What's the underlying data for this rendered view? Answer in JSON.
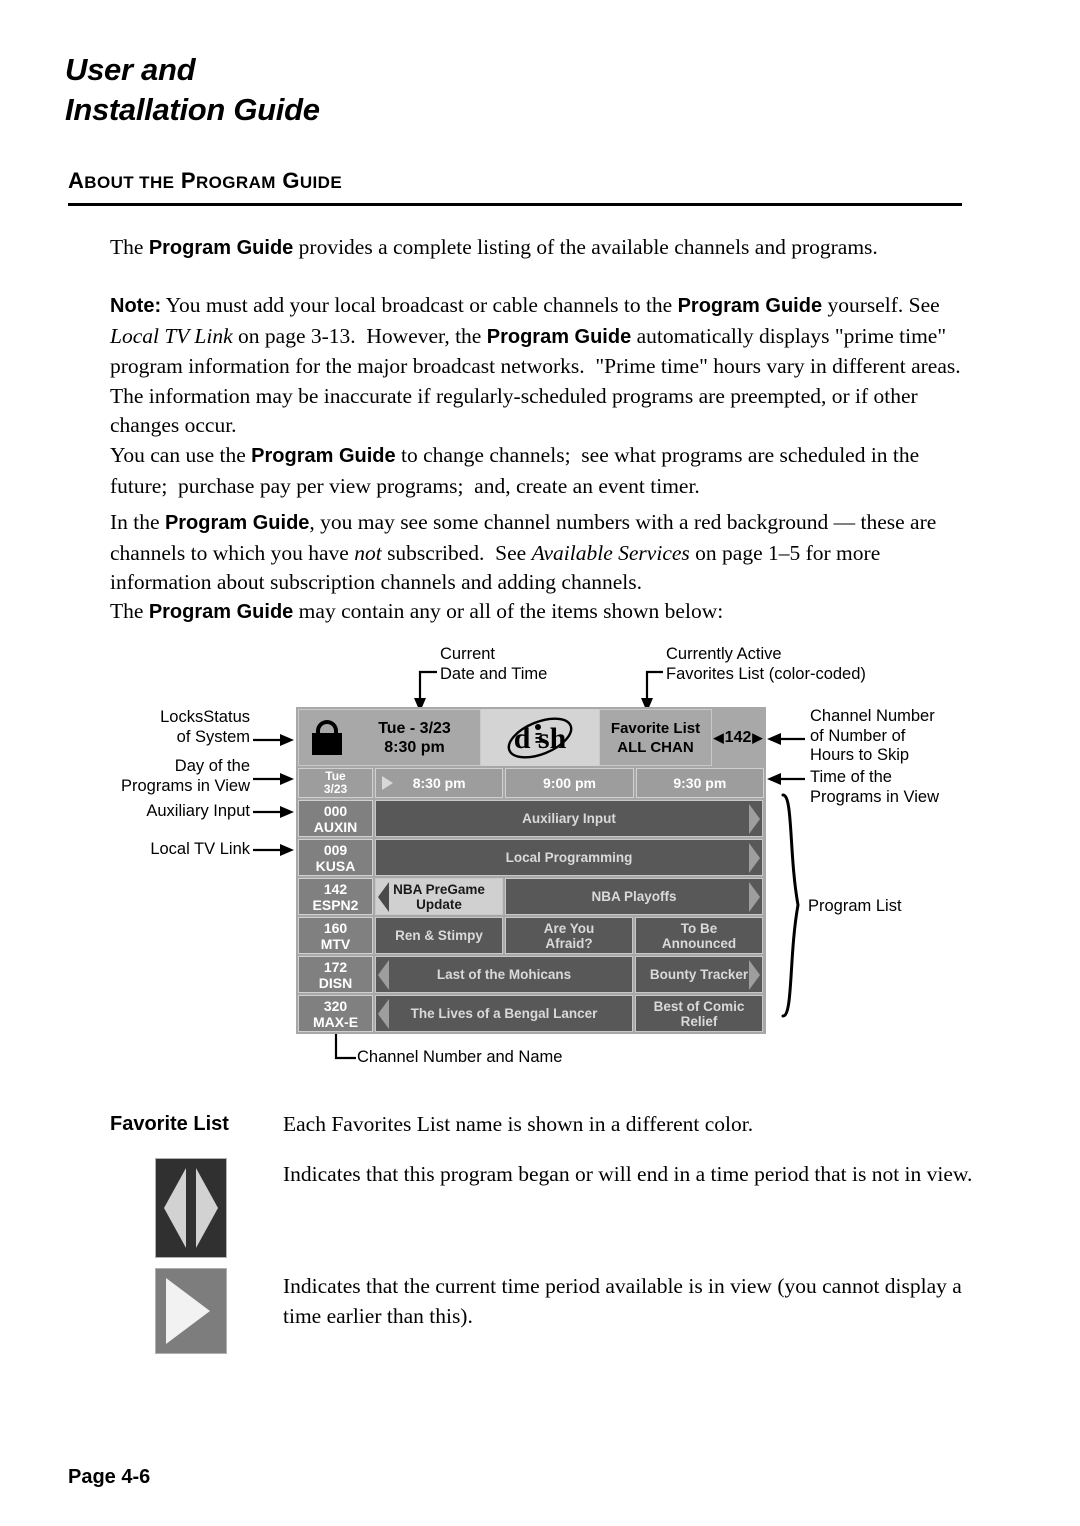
{
  "document": {
    "title_line1": "User and",
    "title_line2": "Installation Guide",
    "section_heading": "About the Program Guide",
    "page_footer": "Page 4-6"
  },
  "paragraphs": {
    "p1_pre": "The ",
    "p1_bold": "Program Guide",
    "p1_post": " provides a complete listing of the available channels and programs.",
    "note_label": "Note:",
    "note_text": "  You must add your local broadcast or cable channels to the Program Guide yourself. See Local TV Link on page 3-13.  However, the Program Guide automatically displays \"prime time\" program information for the major broadcast networks.  \"Prime time\" hours vary in different areas.  The information may be inaccurate if regularly-scheduled programs are preempted, or if other changes occur.",
    "p3": "You can use the Program Guide to change channels;  see what programs are scheduled in the future;  purchase pay per view programs;  and, create an event timer.",
    "p4": "In the Program Guide, you may see some channel numbers with a red background — these are channels to which you have not subscribed.  See Available Services on page 1–5 for more information about subscription channels and adding channels.",
    "p5": "The Program Guide may contain any or all of the items shown below:"
  },
  "guide": {
    "lock_icon": "padlock-icon",
    "date": "Tue - 3/23",
    "time": "8:30 pm",
    "logo": "dish-logo",
    "favorite_label": "Favorite List",
    "favorite_value": "ALL CHAN",
    "channel_skip": "142",
    "skip_left_arrow": "◀",
    "skip_right_arrow": "▶",
    "day_line1": "Tue",
    "day_line2": "3/23",
    "time_columns": [
      "8:30 pm",
      "9:00 pm",
      "9:30 pm"
    ],
    "rows": [
      {
        "number": "000",
        "name": "AUXIN",
        "programs": [
          {
            "title": "Auxiliary Input",
            "span": 3,
            "left_cap": false,
            "right_cap": true,
            "selected": false
          }
        ]
      },
      {
        "number": "009",
        "name": "KUSA",
        "programs": [
          {
            "title": "Local Programming",
            "span": 3,
            "left_cap": false,
            "right_cap": true,
            "selected": false
          }
        ]
      },
      {
        "number": "142",
        "name": "ESPN2",
        "programs": [
          {
            "title": "NBA PreGame Update",
            "span": 1,
            "left_cap": true,
            "right_cap": false,
            "selected": true
          },
          {
            "title": "NBA Playoffs",
            "span": 2,
            "left_cap": false,
            "right_cap": true,
            "selected": false
          }
        ]
      },
      {
        "number": "160",
        "name": "MTV",
        "programs": [
          {
            "title": "Ren & Stimpy",
            "span": 1,
            "left_cap": false,
            "right_cap": false,
            "selected": false
          },
          {
            "title": "Are You Afraid?",
            "span": 1,
            "left_cap": false,
            "right_cap": false,
            "selected": false
          },
          {
            "title": "To Be Announced",
            "span": 1,
            "left_cap": false,
            "right_cap": false,
            "selected": false
          }
        ]
      },
      {
        "number": "172",
        "name": "DISN",
        "programs": [
          {
            "title": "Last of the Mohicans",
            "span": 2,
            "left_cap": true,
            "right_cap": false,
            "selected": false
          },
          {
            "title": "Bounty Tracker",
            "span": 1,
            "left_cap": false,
            "right_cap": true,
            "selected": false
          }
        ]
      },
      {
        "number": "320",
        "name": "MAX-E",
        "programs": [
          {
            "title": "The Lives of a Bengal Lancer",
            "span": 2,
            "left_cap": true,
            "right_cap": false,
            "selected": false
          },
          {
            "title": "Best of Comic Relief",
            "span": 1,
            "left_cap": false,
            "right_cap": false,
            "selected": false
          }
        ]
      }
    ]
  },
  "callouts": {
    "current_datetime": "Current\nDate and Time",
    "favorites_active": "Currently Active\nFavorites List (color-coded)",
    "locks_status": "LocksStatus\nof System",
    "day_of_programs": "Day of the\nPrograms in View",
    "auxiliary_input": "Auxiliary Input",
    "local_tv_link": "Local TV Link",
    "channel_number_skip": "Channel Number\nof Number of\nHours to Skip",
    "time_of_programs": "Time of the\nPrograms in View",
    "program_list": "Program List",
    "channel_number_name": "Channel Number and Name"
  },
  "definitions": {
    "fav_label": "Favorite List",
    "fav_text": "Each Favorites List name is shown in a different color.",
    "icon1_name": "both-ends-out-of-view-icon",
    "icon1_text": "Indicates that this program began or will end in a time period that is not in view.",
    "icon2_name": "earliest-time-in-view-icon",
    "icon2_text": "Indicates that the current time period available is in view (you cannot display a time earlier than this)."
  }
}
